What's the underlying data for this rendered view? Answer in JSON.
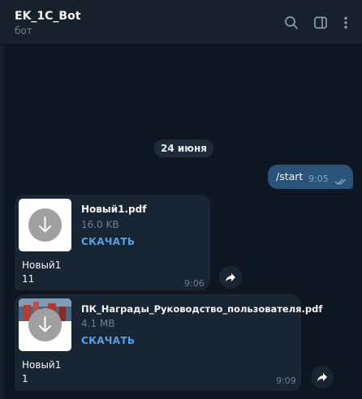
{
  "header": {
    "title": "EK_1C_Bot",
    "subtitle": "бот",
    "icons": [
      "search-icon",
      "sidebar-toggle-icon",
      "more-vert-icon"
    ]
  },
  "chat": {
    "date_separator": "24 июня",
    "outgoing": {
      "text": "/start",
      "time": "9:05",
      "status": "read"
    },
    "files": [
      {
        "name": "Новый1.pdf",
        "size": "16.0 KB",
        "action": "СКАЧАТЬ",
        "caption_line1": "Новый1",
        "caption_line2": "11",
        "time": "9:06"
      },
      {
        "name": "ПК_Награды_Руководство_пользователя.pdf",
        "size": "4.1 MB",
        "action": "СКАЧАТЬ",
        "caption_line1": "Новый1",
        "caption_line2": "1",
        "time": "9:09"
      }
    ]
  },
  "colors": {
    "background": "#0e1621",
    "header": "#17212b",
    "outgoing_bubble": "#2b5278",
    "incoming_bubble": "#182533",
    "accent": "#4fa3e6"
  }
}
